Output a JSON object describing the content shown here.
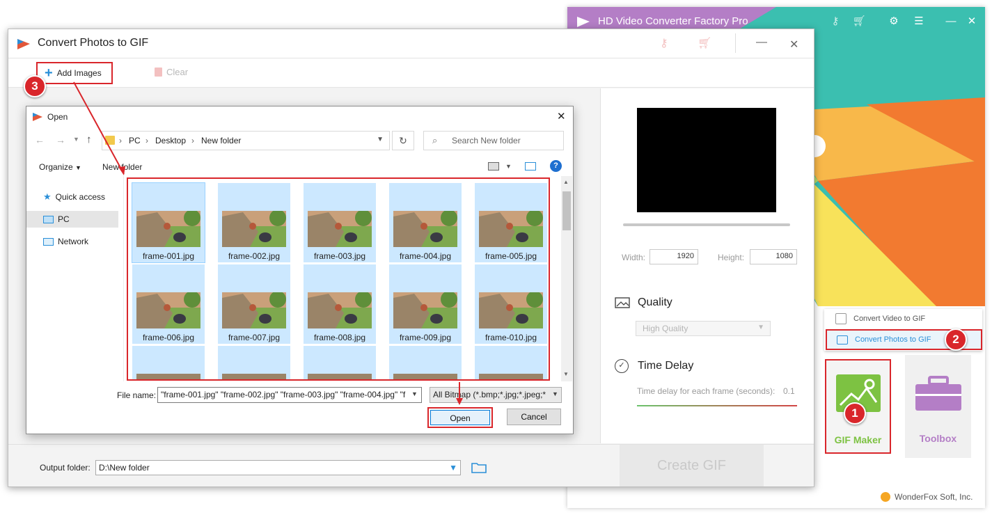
{
  "main_app": {
    "title": "HD Video Converter Factory Pro",
    "menu": [
      {
        "label": "Convert Video to GIF",
        "icon": "film-icon"
      },
      {
        "label": "Convert Photos to GIF",
        "icon": "image-icon"
      }
    ],
    "tiles": [
      {
        "label": "GIF Maker",
        "color": "#7dc242",
        "icon": "image-icon"
      },
      {
        "label": "Toolbox",
        "color": "#b47ec6",
        "icon": "toolbox-icon"
      }
    ],
    "footer": "WonderFox Soft, Inc.",
    "accent_colors": {
      "teal": "#3bbfb0",
      "purple": "#b47ec6",
      "orange": "#f27a30",
      "yellow": "#f8e25a",
      "green": "#7dc242"
    }
  },
  "gif_dialog": {
    "title": "Convert Photos to GIF",
    "toolbar": {
      "add_images": "Add Images",
      "clear": "Clear"
    },
    "settings": {
      "width_label": "Width:",
      "width_value": "1920",
      "height_label": "Height:",
      "height_value": "1080",
      "quality_label": "Quality",
      "quality_value": "High Quality",
      "delay_label": "Time Delay",
      "delay_caption": "Time delay for each frame (seconds):",
      "delay_value": "0.1"
    },
    "output_label": "Output folder:",
    "output_value": "D:\\New folder",
    "create_button": "Create GIF"
  },
  "open_dialog": {
    "title": "Open",
    "breadcrumb": [
      "PC",
      "Desktop",
      "New folder"
    ],
    "search_placeholder": "Search New folder",
    "organize": "Organize",
    "new_folder": "New folder",
    "nav": [
      {
        "label": "Quick access",
        "icon": "star-icon"
      },
      {
        "label": "PC",
        "icon": "computer-icon",
        "selected": true
      },
      {
        "label": "Network",
        "icon": "network-icon"
      }
    ],
    "files": [
      "frame-001.jpg",
      "frame-002.jpg",
      "frame-003.jpg",
      "frame-004.jpg",
      "frame-005.jpg",
      "frame-006.jpg",
      "frame-007.jpg",
      "frame-008.jpg",
      "frame-009.jpg",
      "frame-010.jpg"
    ],
    "filename_label": "File name:",
    "filename_value": "\"frame-001.jpg\" \"frame-002.jpg\" \"frame-003.jpg\" \"frame-004.jpg\" \"f",
    "filter_value": "All Bitmap (*.bmp;*.jpg;*.jpeg;*",
    "open_button": "Open",
    "cancel_button": "Cancel"
  },
  "annotations": [
    {
      "number": "1"
    },
    {
      "number": "2"
    },
    {
      "number": "3"
    }
  ]
}
